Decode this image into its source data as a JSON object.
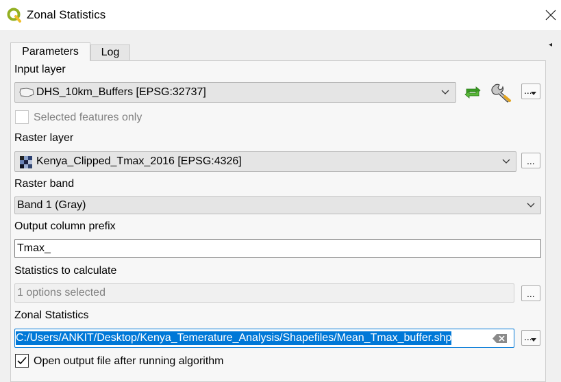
{
  "window": {
    "title": "Zonal Statistics",
    "close_glyph": "✕"
  },
  "tabs": [
    {
      "label": "Parameters",
      "active": true
    },
    {
      "label": "Log",
      "active": false
    }
  ],
  "input_layer": {
    "label": "Input layer",
    "value": "DHS_10km_Buffers [EPSG:32737]",
    "icon": "polygon-layer-icon",
    "iterate_icon": "iterate-icon",
    "settings_icon": "wrench-icon"
  },
  "selected_only": {
    "label": "Selected features only",
    "checked": false,
    "enabled": false
  },
  "raster_layer": {
    "label": "Raster layer",
    "value": "Kenya_Clipped_Tmax_2016 [EPSG:4326]",
    "icon": "raster-layer-icon"
  },
  "raster_band": {
    "label": "Raster band",
    "value": "Band 1 (Gray)"
  },
  "prefix": {
    "label": "Output column prefix",
    "value": "Tmax_"
  },
  "statistics": {
    "label": "Statistics to calculate",
    "value": "1 options selected"
  },
  "output": {
    "label": "Zonal Statistics",
    "value": "C:/Users/ANKIT/Desktop/Kenya_Temerature_Analysis/Shapefiles/Mean_Tmax_buffer.shp",
    "clear_icon": "clear-icon"
  },
  "open_output": {
    "label": "Open output file after running algorithm",
    "checked": true
  },
  "browse_label": "...",
  "colors": {
    "selection": "#0078d7",
    "checkmark": "#000000",
    "iterate_green": "#3a9d23"
  }
}
